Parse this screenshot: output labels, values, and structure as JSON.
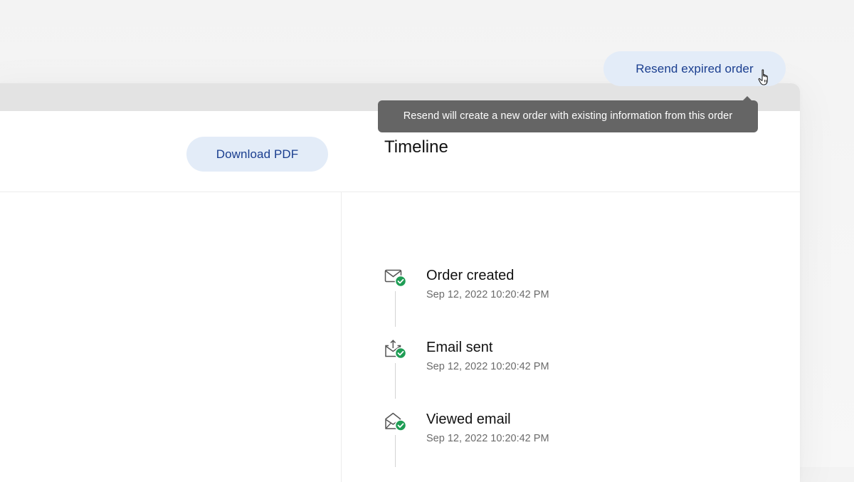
{
  "header": {
    "resend_button_label": "Resend expired order",
    "tooltip": "Resend will create a new order with existing information from this order"
  },
  "left_panel": {
    "download_button_label": "Download PDF"
  },
  "timeline": {
    "title": "Timeline",
    "events": [
      {
        "label": "Order created",
        "timestamp": "Sep 12, 2022 10:20:42 PM",
        "icon": "envelope-check-icon"
      },
      {
        "label": "Email sent",
        "timestamp": "Sep 12, 2022 10:20:42 PM",
        "icon": "email-sent-icon"
      },
      {
        "label": "Viewed email",
        "timestamp": "Sep 12, 2022 10:20:42 PM",
        "icon": "email-opened-icon"
      }
    ]
  },
  "colors": {
    "button_bg": "#e3ecf8",
    "button_text": "#1a3e8f",
    "tooltip_bg": "#656565",
    "success_green": "#1f9d55"
  }
}
